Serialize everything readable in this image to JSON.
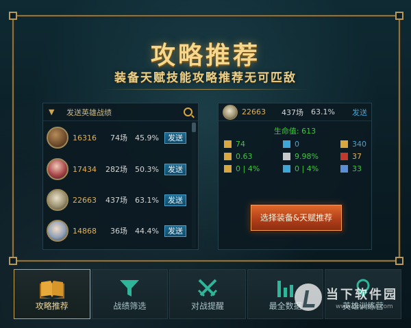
{
  "header": {
    "title": "攻略推荐",
    "subtitle": "装备天赋技能攻略推荐无可匹敌"
  },
  "left_panel": {
    "title": "发送英雄战绩",
    "rows": [
      {
        "id": "16316",
        "games": "74场",
        "rate": "45.9%",
        "button": "发送",
        "avatar_color": "#6d4a2a"
      },
      {
        "id": "17434",
        "games": "282场",
        "rate": "50.3%",
        "button": "发送",
        "avatar_color": "#9a3a3a"
      },
      {
        "id": "22663",
        "games": "437场",
        "rate": "63.1%",
        "button": "发送",
        "avatar_color": "#b9b08a"
      },
      {
        "id": "14868",
        "games": "36场",
        "rate": "44.4%",
        "button": "发送",
        "avatar_color": "#9aa6b8"
      }
    ]
  },
  "right_panel": {
    "hero_id": "22663",
    "games": "437场",
    "rate": "63.1%",
    "send": "发送",
    "hp": "生命值: 613",
    "stats": [
      {
        "icon": "attack-damage-icon",
        "value": "74",
        "color": "#3ec63e",
        "icon_color": "#d9a640"
      },
      {
        "icon": "ability-power-icon",
        "value": "0",
        "color": "#3fa6d8",
        "icon_color": "#3fa6d8"
      },
      {
        "icon": "armor-icon",
        "value": "340",
        "color": "#3fa6d8",
        "icon_color": "#d9a640"
      },
      {
        "icon": "attack-speed-icon",
        "value": "0.63",
        "color": "#3ec63e",
        "icon_color": "#d9a640"
      },
      {
        "icon": "crit-icon",
        "value": "9.98%",
        "color": "#3ec63e",
        "icon_color": "#c9c9c9"
      },
      {
        "icon": "magic-resist-icon",
        "value": "37",
        "color": "#e0b25a",
        "icon_color": "#c0392b"
      },
      {
        "icon": "armor-pen-icon",
        "value": "0 | 4%",
        "color": "#3ec63e",
        "icon_color": "#d9a640"
      },
      {
        "icon": "magic-pen-icon",
        "value": "0 | 4%",
        "color": "#3ec63e",
        "icon_color": "#3fa6d8"
      },
      {
        "icon": "movement-speed-icon",
        "value": "33",
        "color": "#3ec63e",
        "icon_color": "#5a8fd6"
      }
    ],
    "choose_button": "选择装备&天赋推荐"
  },
  "tabs": [
    {
      "label": "攻略推荐",
      "icon": "book-icon",
      "active": true
    },
    {
      "label": "战绩筛选",
      "icon": "filter-icon",
      "active": false
    },
    {
      "label": "对战提醒",
      "icon": "crossed-swords-icon",
      "active": false
    },
    {
      "label": "最全数据",
      "icon": "bar-chart-icon",
      "active": false
    },
    {
      "label": "英雄训练营",
      "icon": "training-icon",
      "active": false
    }
  ],
  "watermark": {
    "title": "当下软件园",
    "url": "www.downxia.com"
  }
}
